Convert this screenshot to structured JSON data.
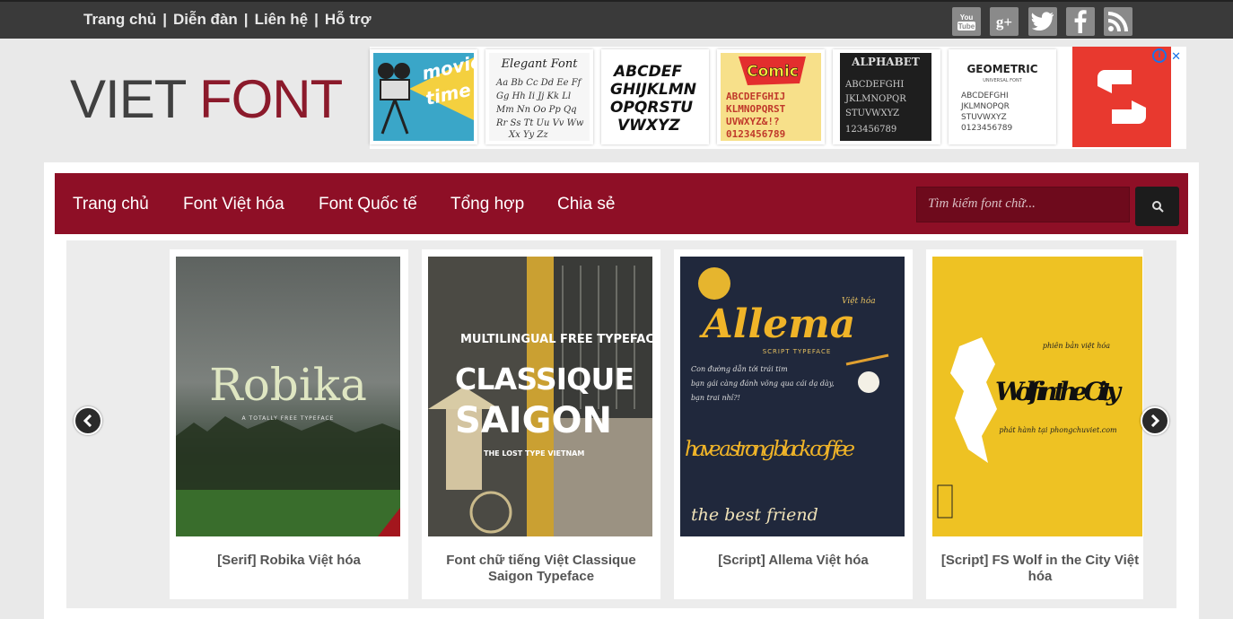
{
  "topbar": {
    "links": [
      "Trang chủ",
      "Diễn đàn",
      "Liên hệ",
      "Hỗ trợ"
    ],
    "separator": "|",
    "social_icons": [
      "youtube-icon",
      "google-plus-icon",
      "twitter-icon",
      "facebook-icon",
      "rss-icon"
    ],
    "social_labels": [
      "You Tube",
      "g+",
      "t",
      "f",
      "rss"
    ]
  },
  "logo": {
    "part1": "VIET",
    "part2": "FONT"
  },
  "ad": {
    "tiles": [
      {
        "label": "movie time"
      },
      {
        "label": "Elegant Font"
      },
      {
        "label": "ABCDEF"
      },
      {
        "label": "Comic Font"
      },
      {
        "label": "ALPHABET"
      },
      {
        "label": "GEOMETRIC"
      }
    ],
    "close": "✕",
    "info": "i"
  },
  "nav": {
    "items": [
      "Trang chủ",
      "Font Việt hóa",
      "Font Quốc tế",
      "Tổng hợp",
      "Chia sẻ"
    ],
    "search_placeholder": "Tìm kiếm font chữ..."
  },
  "cards": [
    {
      "thumb_title": "Robika",
      "thumb_sub": "A TOTALLY FREE TYPEFACE",
      "caption": "[Serif] Robika Việt hóa"
    },
    {
      "thumb_title": "CLASSIQUE SAIGON",
      "thumb_top": "MULTILINGUAL FREE TYPEFACE",
      "thumb_sub": "THE LOST TYPE VIETNAM",
      "caption": "Font chữ tiếng Việt Classique Saigon Typeface"
    },
    {
      "thumb_title": "Allema",
      "thumb_top": "Việt hóa",
      "thumb_sub": "SCRIPT TYPEFACE",
      "thumb_line": "have a strong black coffee",
      "thumb_end": "the best friend",
      "caption": "[Script] Allema Việt hóa"
    },
    {
      "thumb_title": "Wolf in the City",
      "thumb_top": "phiên bản việt hóa",
      "thumb_sub": "phát hành tại phongchuviet.com",
      "caption": "[Script] FS Wolf in the City Việt hóa"
    }
  ],
  "colors": {
    "nav_bg": "#8e0f26",
    "logo_accent": "#8b1a2b",
    "topbar_bg": "#3a3a3a"
  }
}
